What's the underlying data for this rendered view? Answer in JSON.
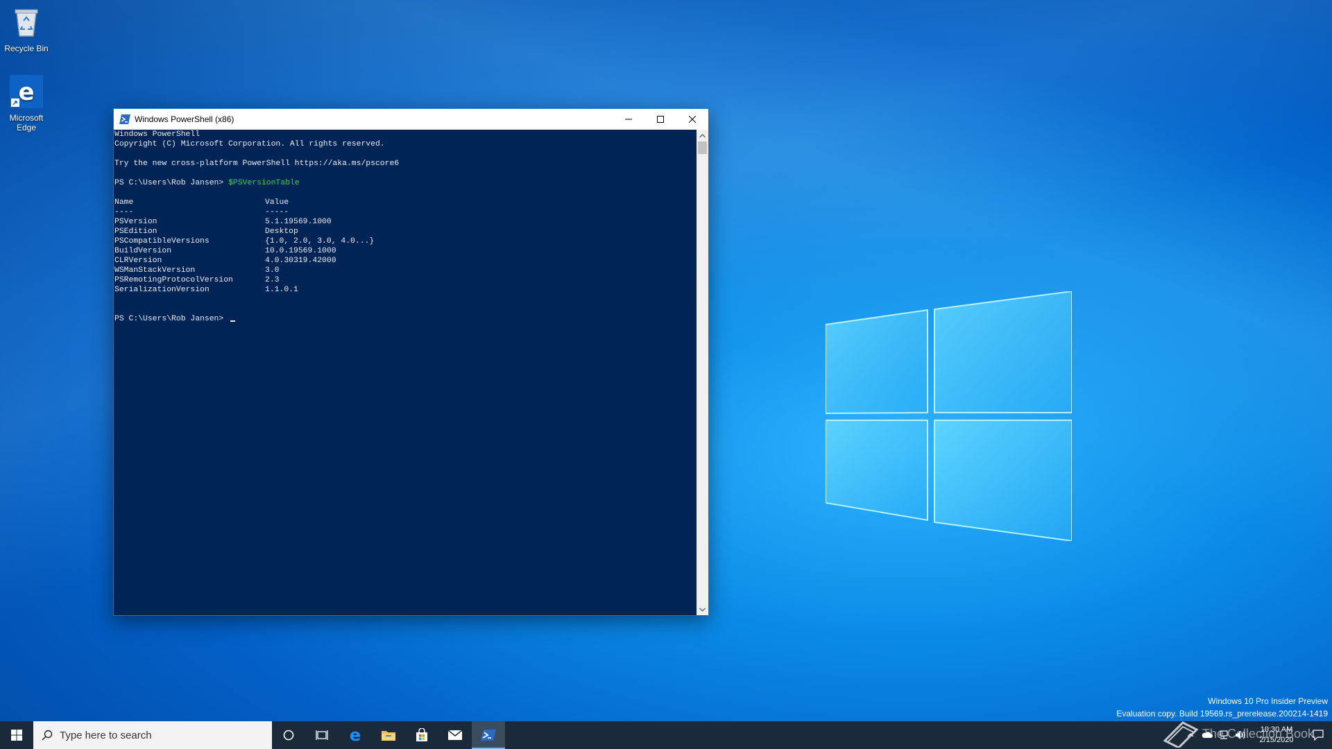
{
  "desktop": {
    "icons": [
      {
        "label": "Recycle Bin",
        "icon": "recycle-bin-icon"
      },
      {
        "label": "Microsoft Edge",
        "icon": "edge-icon"
      }
    ]
  },
  "window": {
    "title": "Windows PowerShell (x86)",
    "icon": "powershell-icon",
    "controls": [
      "minimize-icon",
      "maximize-icon",
      "close-icon"
    ]
  },
  "console": {
    "header_lines": [
      "Windows PowerShell",
      "Copyright (C) Microsoft Corporation. All rights reserved.",
      "",
      "Try the new cross-platform PowerShell https://aka.ms/pscore6",
      ""
    ],
    "prompt": "PS C:\\Users\\Rob Jansen> ",
    "command": "$PSVersionTable",
    "table_header": {
      "name": "Name",
      "value": "Value"
    },
    "table_rule": {
      "name": "----",
      "value": "-----"
    },
    "rows": [
      {
        "name": "PSVersion",
        "value": "5.1.19569.1000"
      },
      {
        "name": "PSEdition",
        "value": "Desktop"
      },
      {
        "name": "PSCompatibleVersions",
        "value": "{1.0, 2.0, 3.0, 4.0...}"
      },
      {
        "name": "BuildVersion",
        "value": "10.0.19569.1000"
      },
      {
        "name": "CLRVersion",
        "value": "4.0.30319.42000"
      },
      {
        "name": "WSManStackVersion",
        "value": "3.0"
      },
      {
        "name": "PSRemotingProtocolVersion",
        "value": "2.3"
      },
      {
        "name": "SerializationVersion",
        "value": "1.1.0.1"
      }
    ],
    "final_prompt": "PS C:\\Users\\Rob Jansen> "
  },
  "watermark": {
    "line1": "Windows 10 Pro Insider Preview",
    "line2": "Evaluation copy. Build 19569.rs_prerelease.200214-1419"
  },
  "taskbar": {
    "search_placeholder": "Type here to search",
    "pinned": [
      "cortana-icon",
      "task-view-icon",
      "edge-icon",
      "file-explorer-icon",
      "store-icon",
      "mail-icon",
      "powershell-icon"
    ],
    "active": "powershell-icon",
    "clock_time": "10:30 AM",
    "clock_date": "2/15/2020",
    "overlay_text": "The Collection Book"
  },
  "colors": {
    "console_bg": "#012456",
    "console_fg": "#eeedf0",
    "command_green": "#2ed24a",
    "taskbar_bg": "#1b2a3a"
  }
}
